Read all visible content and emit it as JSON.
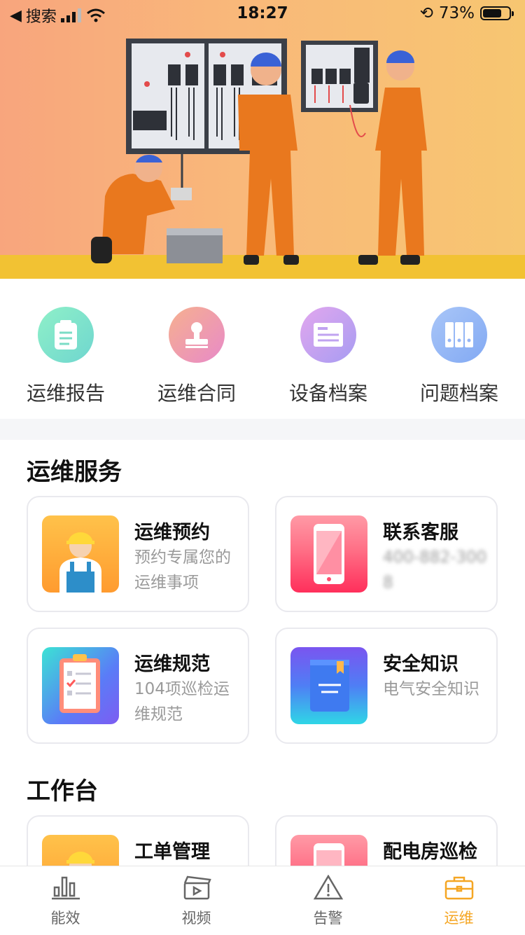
{
  "status_bar": {
    "back_label": "搜索",
    "time": "18:27",
    "battery_percent": "73%",
    "battery_level": 0.73
  },
  "quick_actions": [
    {
      "label": "运维报告",
      "icon": "clipboard-icon",
      "color": "#7be0c0"
    },
    {
      "label": "运维合同",
      "icon": "stamp-icon",
      "color": "#f19bb0"
    },
    {
      "label": "设备档案",
      "icon": "id-card-icon",
      "color": "#c79ff0"
    },
    {
      "label": "问题档案",
      "icon": "folders-icon",
      "color": "#8fb6f6"
    }
  ],
  "service_section": {
    "title": "运维服务",
    "cards": [
      {
        "title": "运维预约",
        "desc": "预约专属您的运维事项",
        "icon": "worker-icon"
      },
      {
        "title": "联系客服",
        "desc": "400-882-3008",
        "icon": "phone-icon"
      },
      {
        "title": "运维规范",
        "desc": "104项巡检运维规范",
        "icon": "checklist-icon"
      },
      {
        "title": "安全知识",
        "desc": "电气安全知识",
        "icon": "book-icon"
      }
    ]
  },
  "workbench_section": {
    "title": "工作台",
    "cards": [
      {
        "title": "工单管理",
        "icon": "worker-icon"
      },
      {
        "title": "配电房巡检",
        "icon": "phone-icon"
      }
    ]
  },
  "tabbar": {
    "items": [
      {
        "label": "能效",
        "icon": "bar-chart-icon",
        "active": false
      },
      {
        "label": "视频",
        "icon": "clapperboard-icon",
        "active": false
      },
      {
        "label": "告警",
        "icon": "warning-icon",
        "active": false
      },
      {
        "label": "运维",
        "icon": "toolbox-icon",
        "active": true
      }
    ],
    "active_color": "#f5a623"
  }
}
